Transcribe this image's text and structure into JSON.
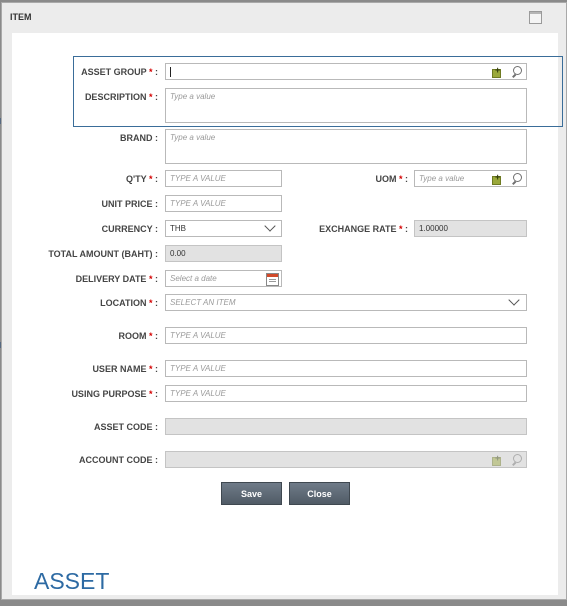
{
  "dialog": {
    "title": "ITEM"
  },
  "form": {
    "asset_group": {
      "label": "ASSET GROUP",
      "required": "*",
      "value": ""
    },
    "description": {
      "label": "DESCRIPTION",
      "required": "*",
      "placeholder": "Type a value"
    },
    "brand": {
      "label": "BRAND",
      "placeholder": "Type a value"
    },
    "qty": {
      "label": "Q'TY",
      "required": "*",
      "placeholder": "TYPE A VALUE"
    },
    "uom": {
      "label": "UOM",
      "required": "*",
      "placeholder": "Type a value"
    },
    "unit_price": {
      "label": "UNIT PRICE",
      "placeholder": "TYPE A VALUE"
    },
    "currency": {
      "label": "CURRENCY",
      "value": "THB"
    },
    "exchange_rate": {
      "label": "EXCHANGE RATE",
      "required": "*",
      "value": "1.00000"
    },
    "total_amount": {
      "label": "TOTAL AMOUNT (BAHT)",
      "value": "0.00"
    },
    "delivery_date": {
      "label": "DELIVERY DATE",
      "required": "*",
      "placeholder": "Select a date"
    },
    "location": {
      "label": "LOCATION",
      "required": "*",
      "placeholder": "SELECT AN ITEM"
    },
    "room": {
      "label": "ROOM",
      "required": "*",
      "placeholder": "TYPE A VALUE"
    },
    "user_name": {
      "label": "USER NAME",
      "required": "*",
      "placeholder": "TYPE A VALUE"
    },
    "using_purpose": {
      "label": "USING PURPOSE",
      "required": "*",
      "placeholder": "TYPE A VALUE"
    },
    "asset_code": {
      "label": "ASSET CODE",
      "value": ""
    },
    "account_code": {
      "label": "ACCOUNT CODE",
      "value": ""
    },
    "colon": ":"
  },
  "buttons": {
    "save": "Save",
    "close": "Close"
  },
  "brand_text": "ASSET",
  "colors": {
    "required": "#d40000",
    "button": "#5d6873",
    "brand": "#2d6aa3",
    "focus_frame": "#3a6d99"
  }
}
